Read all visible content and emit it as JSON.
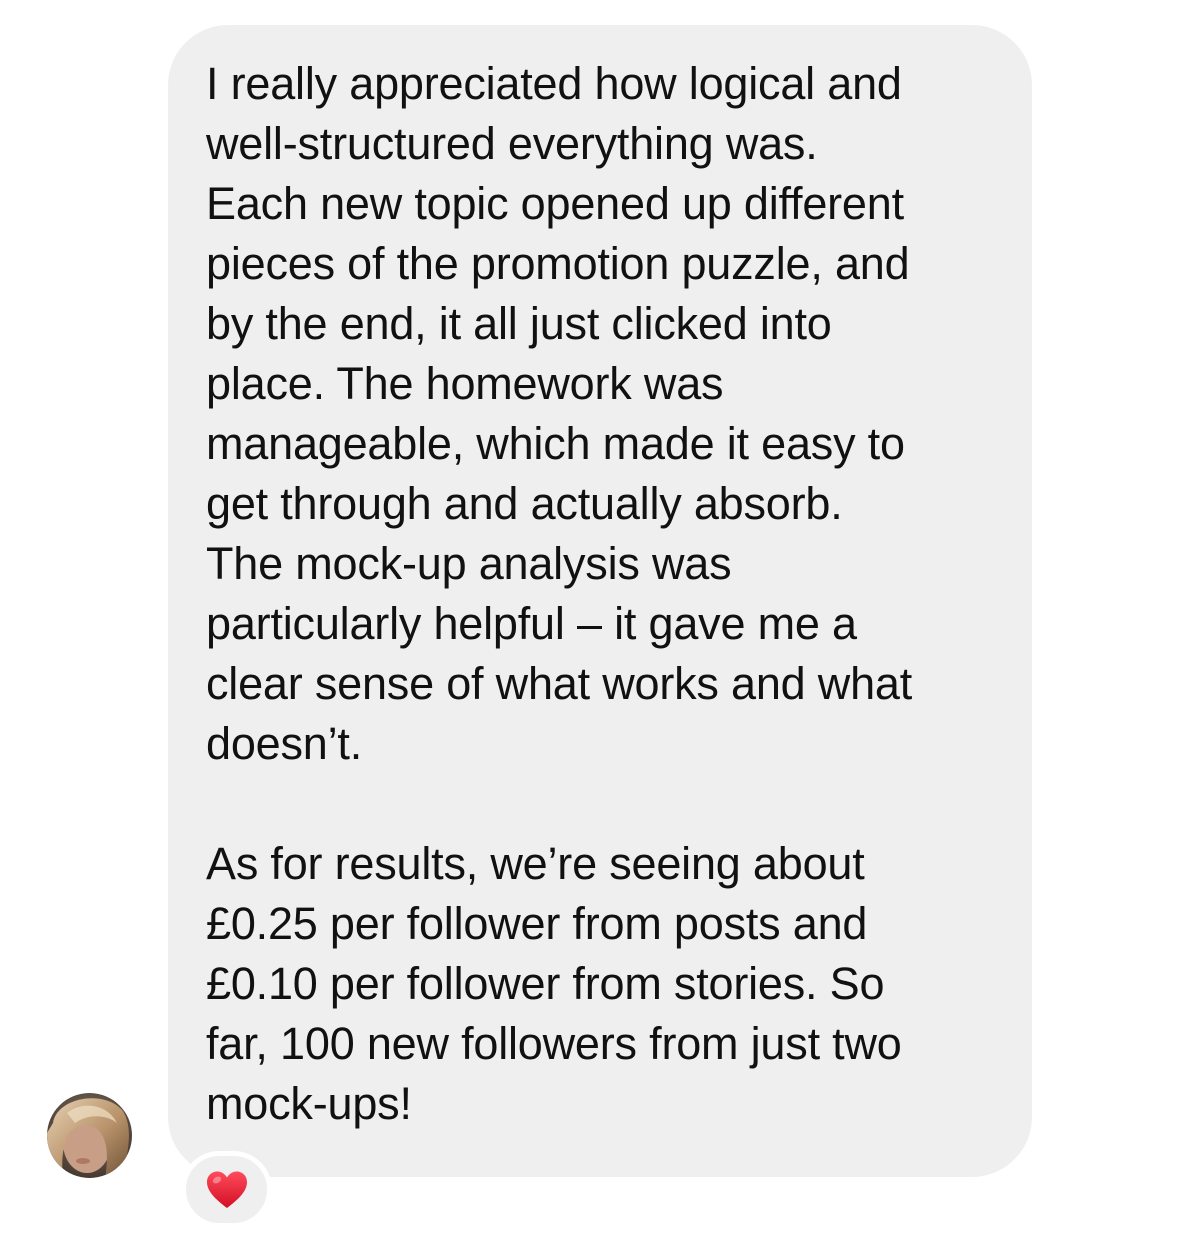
{
  "message": {
    "paragraphs": [
      {
        "lines": [
          "I really appreciated how logical and",
          "well-structured everything was.",
          "Each new topic opened up different",
          "pieces of the promotion puzzle, and",
          "by the end, it all just clicked into",
          "place. The homework was",
          "manageable, which made it easy to",
          "get through and actually absorb.",
          "The mock-up analysis was",
          "particularly helpful – it gave me a",
          "clear sense of what works and what",
          "doesn’t."
        ]
      },
      {
        "lines": [
          "As for results, we’re seeing about",
          "£0.25 per follower from posts and",
          "£0.10 per follower from stories. So",
          "far, 100 new followers from just two",
          "mock-ups!"
        ]
      }
    ]
  },
  "reaction": {
    "icon": "red-heart-icon",
    "color": "#e0142a"
  },
  "avatar": {
    "icon": "sender-avatar"
  },
  "colors": {
    "bubble": "#efefef",
    "text": "#111111",
    "background": "#ffffff"
  }
}
